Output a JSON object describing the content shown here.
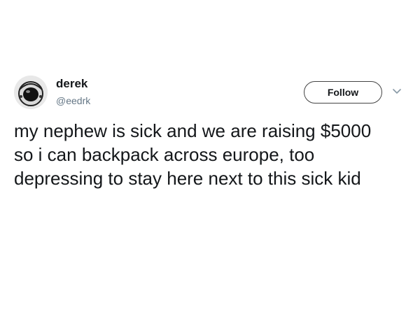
{
  "user": {
    "display_name": "derek",
    "handle": "@eedrk",
    "avatar_icon": "astronaut-helmet-avatar"
  },
  "actions": {
    "follow_label": "Follow",
    "menu_icon": "chevron-down-icon"
  },
  "tweet": {
    "lines": [
      "my nephew is sick and we are raising $5000",
      "so i can backpack across europe, too",
      "depressing to stay here next to this sick kid"
    ]
  }
}
